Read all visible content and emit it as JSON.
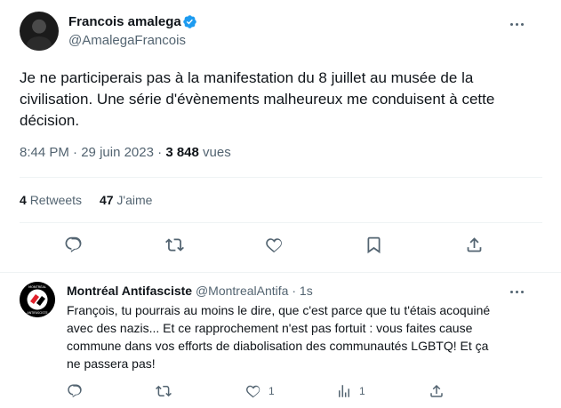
{
  "tweet": {
    "author_name": "Francois amalega",
    "handle": "@AmalegaFrancois",
    "text": "Je ne participerais pas à la manifestation du 8 juillet au musée de la civilisation. Une série d'évènements malheureux me conduisent à cette décision.",
    "time": "8:44 PM",
    "separator": "·",
    "date": "29 juin 2023",
    "views_count": "3 848",
    "views_label": "vues",
    "retweets_count": "4",
    "retweets_label": "Retweets",
    "likes_count": "47",
    "likes_label": "J'aime",
    "accent_color": "#1d9bf0"
  },
  "actions": {
    "icons": [
      "reply-icon",
      "retweet-icon",
      "like-icon",
      "bookmark-icon",
      "share-icon"
    ]
  },
  "reply": {
    "author_name": "Montréal Antifasciste",
    "handle": "@MontrealAntifa",
    "separator": "·",
    "time": "1s",
    "text": "François, tu pourrais au moins le dire, que c'est parce que tu t'étais acoquiné avec des nazis... Et ce rapprochement n'est pas fortuit : vous faites cause commune dans vos efforts de diabolisation des communautés LGBTQ! Et ça ne passera pas!",
    "avatar_text_top": "MONTRÉAL",
    "avatar_text_bottom": "ANTIFASCISTE",
    "avatar_color": "#e0202a",
    "like_count": "1",
    "views_count": "1"
  }
}
